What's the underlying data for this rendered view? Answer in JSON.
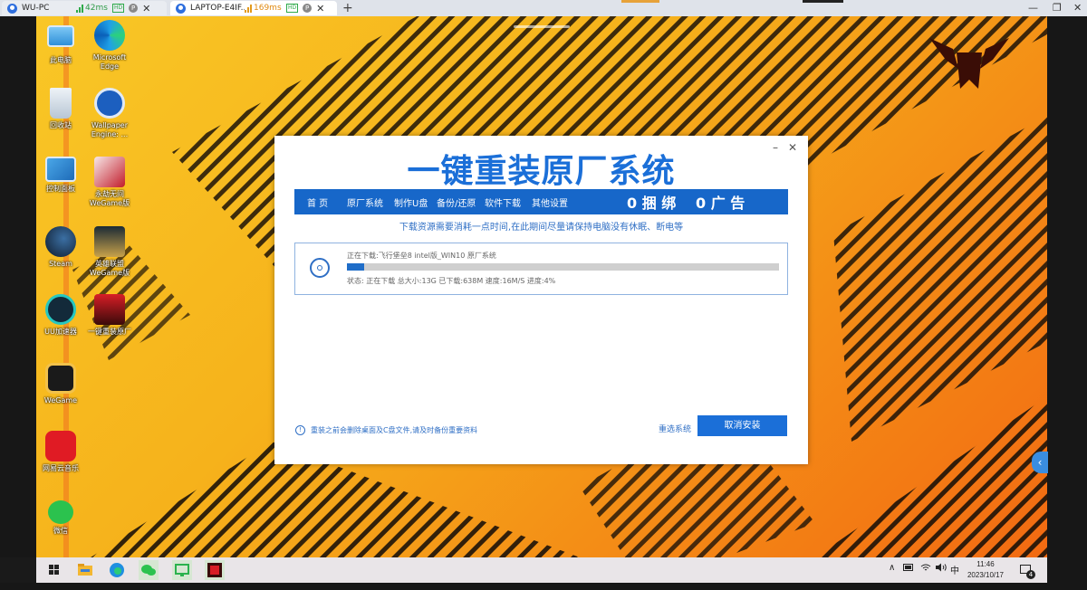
{
  "remote_tabs": [
    {
      "name": "WU-PC",
      "ping": "42ms",
      "hd": "HD",
      "p": "P"
    },
    {
      "name": "LAPTOP-E4IF...",
      "ping": "169ms",
      "hd": "HD",
      "p": "P"
    }
  ],
  "remote_bar": {
    "plus": "+",
    "close": "✕",
    "min": "—",
    "restore": "❐"
  },
  "desktop_icons": [
    {
      "label": "此电脑"
    },
    {
      "label": "Microsoft Edge"
    },
    {
      "label": "回收站"
    },
    {
      "label": "Wallpaper Engine: ..."
    },
    {
      "label": "控制面板"
    },
    {
      "label": "永劫无间 WeGame版"
    },
    {
      "label": "Steam"
    },
    {
      "label": "英雄联盟 WeGame版"
    },
    {
      "label": "UU加速器"
    },
    {
      "label": "一键重装原厂"
    },
    {
      "label": "WeGame"
    },
    {
      "label": "网易云音乐"
    },
    {
      "label": "微信"
    }
  ],
  "installer": {
    "title": "一键重装原厂系统",
    "min": "–",
    "close": "✕",
    "nav": [
      "首 页",
      "原厂系统",
      "制作U盘",
      "备份/还原",
      "软件下载",
      "其他设置"
    ],
    "promo1": "0 捆 绑",
    "promo2": "0 广 告",
    "notice": "下载资源需要消耗一点时间,在此期间尽量请保持电脑没有休眠、断电等",
    "task_title": "正在下载:飞行堡垒8 intel版_WIN10 原厂系统",
    "task_status": "状态: 正在下载  总大小:13G  已下载:638M  速度:16M/S  进度:4%",
    "progress": 0.04,
    "warning_icon": "!",
    "warning": "重装之前会删除桌面及C盘文件,请及时备份重要资料",
    "reselect": "重选系统",
    "cancel": "取消安装"
  },
  "taskbar": {
    "tray_ime": "中",
    "tray_up": "∧",
    "time": "11:46",
    "date": "2023/10/17",
    "notifications": "4"
  },
  "fold": "‹",
  "colors": {
    "accent": "#1b6fd8",
    "nav": "#1767c9",
    "wallpaper": "#f6b21b"
  }
}
